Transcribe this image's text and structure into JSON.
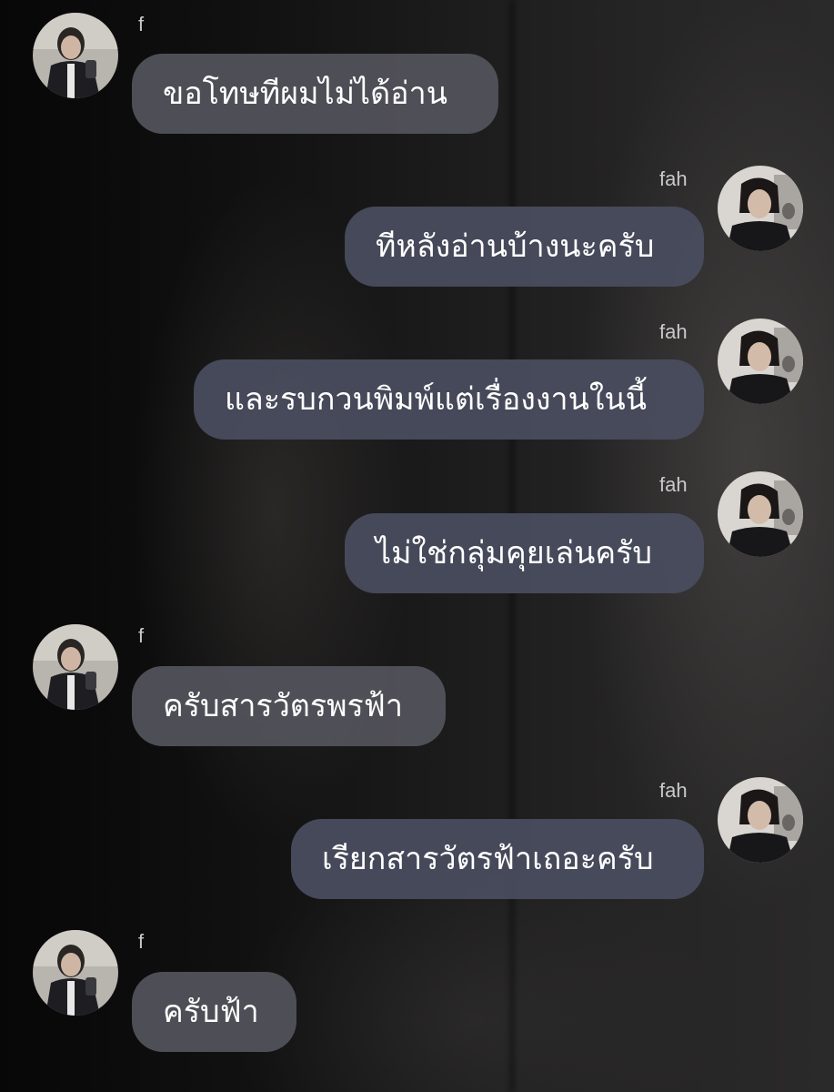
{
  "participants": {
    "left": {
      "name": "f"
    },
    "right": {
      "name": "fah"
    }
  },
  "messages": [
    {
      "sender": "f",
      "text": "ขอโทษทีผมไม่ได้อ่าน"
    },
    {
      "sender": "fah",
      "text": "ทีหลังอ่านบ้างนะครับ"
    },
    {
      "sender": "fah",
      "text": "และรบกวนพิมพ์แต่เรื่องงานในนี้"
    },
    {
      "sender": "fah",
      "text": "ไม่ใช่กลุ่มคุยเล่นครับ"
    },
    {
      "sender": "f",
      "text": "ครับสารวัตรพรฟ้า"
    },
    {
      "sender": "fah",
      "text": "เรียกสารวัตรฟ้าเถอะครับ"
    },
    {
      "sender": "f",
      "text": "ครับฟ้า"
    }
  ],
  "colors": {
    "incoming_bubble": "#54545c",
    "outgoing_bubble": "#484c5e",
    "name_text": "#c9c9c9"
  }
}
